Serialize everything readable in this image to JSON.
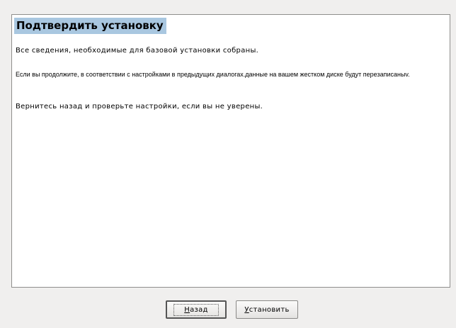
{
  "dialog": {
    "title": "Подтвердить установку",
    "paragraphs": [
      "Все сведения, необходимые для базовой установки собраны.",
      "Если вы продолжите, в соответствии с настройками в предыдущих диалогах.данные на вашем жестком диске будут перезаписаныv.",
      "Вернитесь назад и проверьте настройки, если вы не уверены."
    ]
  },
  "buttons": {
    "back": {
      "mnemonic": "Н",
      "rest": "азад"
    },
    "install": {
      "mnemonic": "У",
      "rest": "становить"
    }
  }
}
